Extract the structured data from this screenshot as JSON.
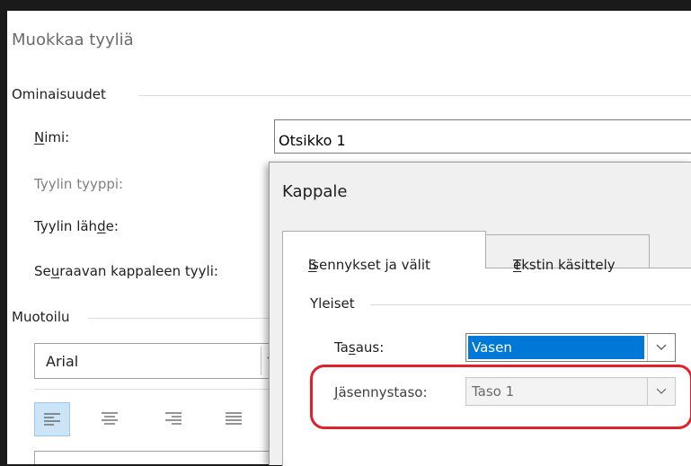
{
  "edit_style": {
    "title": "Muokkaa tyyliä",
    "properties_group": "Ominaisuudet",
    "name_label": {
      "pre": "",
      "ul": "N",
      "post": "imi:"
    },
    "name_value": "Otsikko 1",
    "style_type_label": "Tyylin tyyppi:",
    "style_based_on_label": {
      "pre": "Tyylin läh",
      "ul": "d",
      "post": "e:"
    },
    "following_style_label": {
      "pre": "Se",
      "ul": "u",
      "post": "raavan kappaleen tyyli:"
    },
    "formatting_group": "Muotoilu",
    "font_value": "Arial",
    "alignment_buttons": [
      "align-left-icon",
      "align-center-icon",
      "align-right-icon",
      "align-justify-icon"
    ]
  },
  "paragraph_dialog": {
    "title": "Kappale",
    "tabs": [
      {
        "pre": "",
        "ul": "S",
        "post": "isennykset ja välit",
        "active": true
      },
      {
        "pre": "",
        "ul": "T",
        "post": "ekstin käsittely",
        "active": false
      }
    ],
    "general_group": "Yleiset",
    "alignment_label": {
      "pre": "Ta",
      "ul": "s",
      "post": "aus:"
    },
    "alignment_value": "Vasen",
    "outline_label": {
      "pre": "",
      "ul": "J",
      "post": "äsennystaso:"
    },
    "outline_value": "Taso 1"
  },
  "colors": {
    "highlight_ring": "#e0202a",
    "selection": "#0078d7"
  }
}
